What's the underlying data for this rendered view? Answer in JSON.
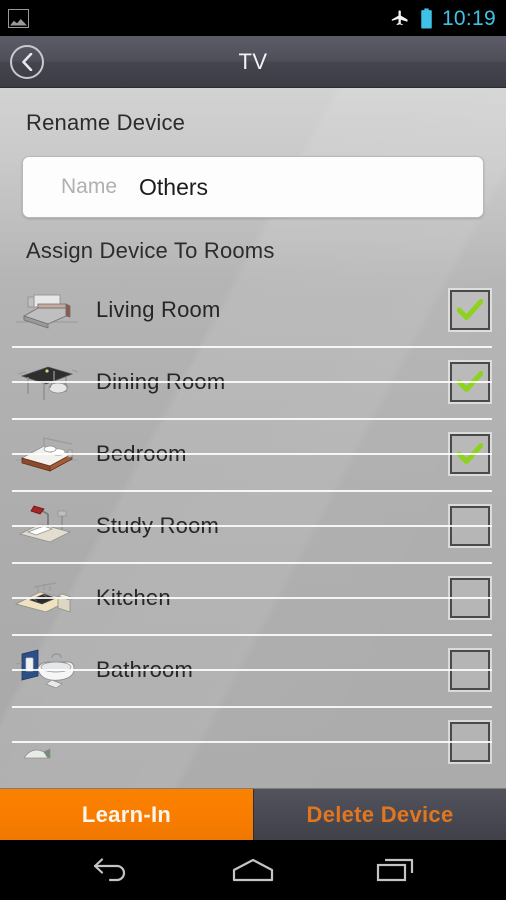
{
  "statusbar": {
    "screenshot_icon": "image-notification-icon",
    "airplane_icon": "airplane-mode-icon",
    "battery_icon": "battery-icon",
    "time": "10:19",
    "clock_color": "#3ec2e8"
  },
  "titlebar": {
    "back_icon": "chevron-left-icon",
    "title": "TV"
  },
  "rename": {
    "section_title": "Rename Device",
    "field_label": "Name",
    "field_value": "Others",
    "field_placeholder": "Name"
  },
  "assign": {
    "section_title": "Assign Device To Rooms",
    "rooms": [
      {
        "name": "Living Room",
        "icon": "sofa-icon",
        "checked": true
      },
      {
        "name": "Dining Room",
        "icon": "dining-table-icon",
        "checked": true
      },
      {
        "name": "Bedroom",
        "icon": "bed-icon",
        "checked": true
      },
      {
        "name": "Study Room",
        "icon": "desk-lamp-icon",
        "checked": false
      },
      {
        "name": "Kitchen",
        "icon": "kitchen-icon",
        "checked": false
      },
      {
        "name": "Bathroom",
        "icon": "bathtub-icon",
        "checked": false
      },
      {
        "name": "",
        "icon": "partial-room-icon",
        "checked": false
      }
    ]
  },
  "actions": {
    "learn_in_label": "Learn-In",
    "delete_label": "Delete Device",
    "learn_in_color": "#f97d00",
    "delete_text_color": "#e2761f"
  },
  "navbar": {
    "back_icon": "nav-back-icon",
    "home_icon": "nav-home-icon",
    "recents_icon": "nav-recents-icon"
  }
}
